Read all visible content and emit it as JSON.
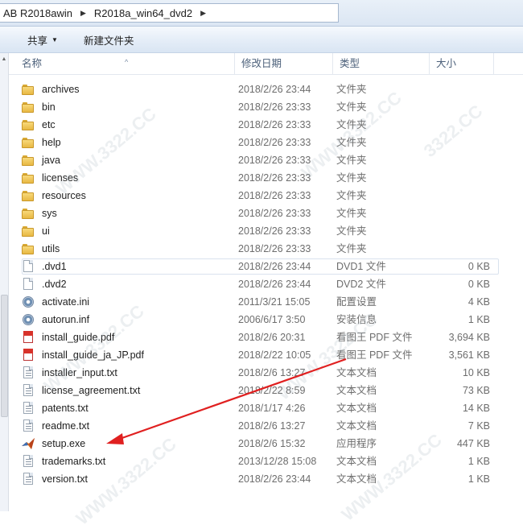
{
  "address": {
    "crumbs": [
      "AB R2018awin",
      "R2018a_win64_dvd2"
    ]
  },
  "toolbar": {
    "share_label": "共享",
    "new_folder_label": "新建文件夹"
  },
  "columns": {
    "name": "名称",
    "date": "修改日期",
    "type": "类型",
    "size": "大小"
  },
  "files": [
    {
      "name": "archives",
      "date": "2018/2/26 23:44",
      "type": "文件夹",
      "size": "",
      "icon": "folder-icon"
    },
    {
      "name": "bin",
      "date": "2018/2/26 23:33",
      "type": "文件夹",
      "size": "",
      "icon": "folder-icon"
    },
    {
      "name": "etc",
      "date": "2018/2/26 23:33",
      "type": "文件夹",
      "size": "",
      "icon": "folder-icon"
    },
    {
      "name": "help",
      "date": "2018/2/26 23:33",
      "type": "文件夹",
      "size": "",
      "icon": "folder-icon"
    },
    {
      "name": "java",
      "date": "2018/2/26 23:33",
      "type": "文件夹",
      "size": "",
      "icon": "folder-icon"
    },
    {
      "name": "licenses",
      "date": "2018/2/26 23:33",
      "type": "文件夹",
      "size": "",
      "icon": "folder-icon"
    },
    {
      "name": "resources",
      "date": "2018/2/26 23:33",
      "type": "文件夹",
      "size": "",
      "icon": "folder-icon"
    },
    {
      "name": "sys",
      "date": "2018/2/26 23:33",
      "type": "文件夹",
      "size": "",
      "icon": "folder-icon"
    },
    {
      "name": "ui",
      "date": "2018/2/26 23:33",
      "type": "文件夹",
      "size": "",
      "icon": "folder-icon"
    },
    {
      "name": "utils",
      "date": "2018/2/26 23:33",
      "type": "文件夹",
      "size": "",
      "icon": "folder-icon"
    },
    {
      "name": ".dvd1",
      "date": "2018/2/26 23:44",
      "type": "DVD1 文件",
      "size": "0 KB",
      "icon": "file-icon"
    },
    {
      "name": ".dvd2",
      "date": "2018/2/26 23:44",
      "type": "DVD2 文件",
      "size": "0 KB",
      "icon": "file-icon"
    },
    {
      "name": "activate.ini",
      "date": "2011/3/21 15:05",
      "type": "配置设置",
      "size": "4 KB",
      "icon": "settings-file-icon"
    },
    {
      "name": "autorun.inf",
      "date": "2006/6/17 3:50",
      "type": "安装信息",
      "size": "1 KB",
      "icon": "settings-file-icon"
    },
    {
      "name": "install_guide.pdf",
      "date": "2018/2/6 20:31",
      "type": "看图王 PDF 文件",
      "size": "3,694 KB",
      "icon": "pdf-file-icon"
    },
    {
      "name": "install_guide_ja_JP.pdf",
      "date": "2018/2/22 10:05",
      "type": "看图王 PDF 文件",
      "size": "3,561 KB",
      "icon": "pdf-file-icon"
    },
    {
      "name": "installer_input.txt",
      "date": "2018/2/6 13:27",
      "type": "文本文档",
      "size": "10 KB",
      "icon": "text-file-icon"
    },
    {
      "name": "license_agreement.txt",
      "date": "2018/2/22 8:59",
      "type": "文本文档",
      "size": "73 KB",
      "icon": "text-file-icon"
    },
    {
      "name": "patents.txt",
      "date": "2018/1/17 4:26",
      "type": "文本文档",
      "size": "14 KB",
      "icon": "text-file-icon"
    },
    {
      "name": "readme.txt",
      "date": "2018/2/6 13:27",
      "type": "文本文档",
      "size": "7 KB",
      "icon": "text-file-icon"
    },
    {
      "name": "setup.exe",
      "date": "2018/2/6 15:32",
      "type": "应用程序",
      "size": "447 KB",
      "icon": "matlab-setup-icon"
    },
    {
      "name": "trademarks.txt",
      "date": "2013/12/28 15:08",
      "type": "文本文档",
      "size": "1 KB",
      "icon": "text-file-icon"
    },
    {
      "name": "version.txt",
      "date": "2018/2/26 23:44",
      "type": "文本文档",
      "size": "1 KB",
      "icon": "text-file-icon"
    }
  ],
  "highlighted_row": ".dvd1",
  "colors": {
    "annotation_arrow": "#e02020",
    "folder": "#f2c85a"
  }
}
